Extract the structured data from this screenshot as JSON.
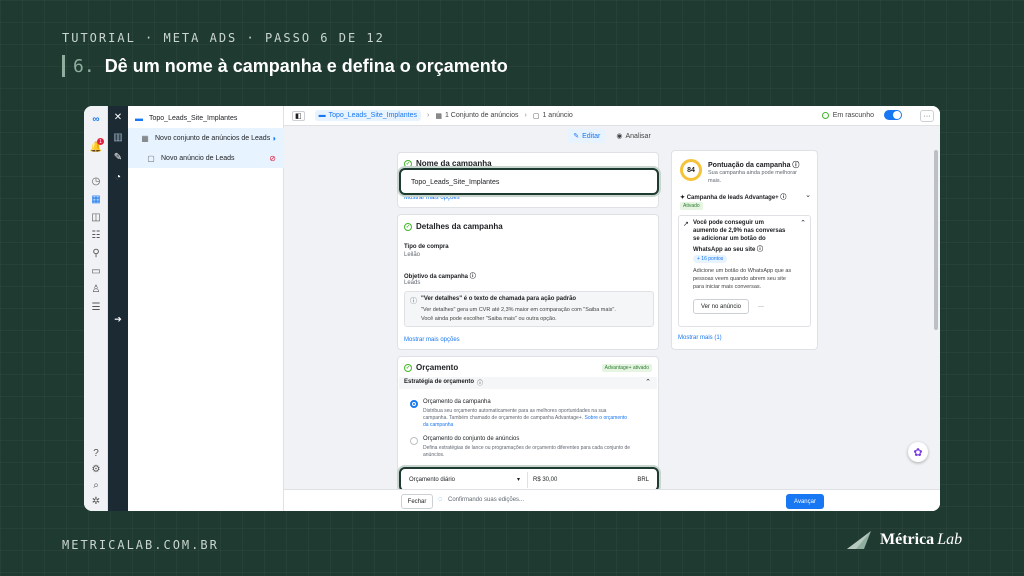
{
  "slide": {
    "kicker": "TUTORIAL · META ADS · PASSO 6 DE 12",
    "step_number": "6.",
    "step_title": "Dê um nome à campanha e defina o orçamento",
    "footer_url": "METRICALAB.COM.BR",
    "brand_name": "Métrica",
    "brand_suffix": "Lab"
  },
  "colors": {
    "background": "#1f3a31",
    "accent": "#1877f2",
    "highlight_border": "#1f3a31"
  },
  "rail": {
    "icons": [
      "meta-logo-icon",
      "notifications-icon",
      "dashboard-icon",
      "campaigns-icon",
      "audiences-icon",
      "tools-icon",
      "billing-icon",
      "people-icon",
      "menu-icon",
      "help-icon",
      "settings-icon",
      "search-icon",
      "bug-icon"
    ],
    "notification_count": "1"
  },
  "tree": {
    "items": [
      {
        "label": "Topo_Leads_Site_Implantes"
      },
      {
        "label": "Novo conjunto de anúncios de Leads"
      },
      {
        "label": "Novo anúncio de Leads"
      }
    ]
  },
  "topbar": {
    "crumb_campaign": "Topo_Leads_Site_Implantes",
    "crumb_adset": "1 Conjunto de anúncios",
    "crumb_ad": "1 anúncio",
    "status": "Em rascunho",
    "more": "···"
  },
  "modes": {
    "edit": "Editar",
    "review": "Analisar"
  },
  "name_card": {
    "title": "Nome da campanha",
    "value": "Topo_Leads_Site_Implantes",
    "more_options": "Mostrar mais opções"
  },
  "details_card": {
    "title": "Detalhes da campanha",
    "buy_type_label": "Tipo de compra",
    "buy_type_value": "Leilão",
    "objective_label": "Objetivo da campanha",
    "objective_value": "Leads",
    "info_title": "\"Ver detalhes\" é o texto de chamada para ação padrão",
    "info_body_1": "\"Ver detalhes\" gera um CVR até 2,3% maior em comparação com \"Saiba mais\".",
    "info_body_2": "Você ainda pode escolher \"Saiba mais\" ou outra opção.",
    "more_options": "Mostrar mais opções"
  },
  "budget_card": {
    "title": "Orçamento",
    "advantage_tag": "Advantage+ ativado",
    "strategy_label": "Estratégia de orçamento",
    "option1_title": "Orçamento da campanha",
    "option1_desc_1": "Distribua seu orçamento automaticamente para as melhores oportunidades na sua",
    "option1_desc_2": "campanha. Também chamado de orçamento de campanha Advantage+.",
    "option1_link": "Sobre o orçamento",
    "option1_link_2": "da campanha",
    "option2_title": "Orçamento do conjunto de anúncios",
    "option2_desc_1": "Defina estratégias de lance ou programações de orçamento diferentes para cada conjunto de",
    "option2_desc_2": "anúncios.",
    "budget_type": "Orçamento diário",
    "budget_amount": "R$ 30,00",
    "currency": "BRL"
  },
  "score_panel": {
    "score": "84",
    "title": "Pontuação da campanha",
    "subtitle_1": "Sua campanha ainda pode melhorar",
    "subtitle_2": "mais.",
    "advantage_label": "Campanha de leads Advantage+",
    "advantage_status": "Ativado",
    "tip_title_1": "Você pode conseguir um",
    "tip_title_2": "aumento de 2,9% nas conversas",
    "tip_title_3": "se adicionar um botão do",
    "tip_title_4": "WhatsApp ao seu site",
    "points": "+ 16 pontos",
    "tip_body_1": "Adicione um botão do WhatsApp que as",
    "tip_body_2": "pessoas veem quando abrem seu site",
    "tip_body_3": "para iniciar mais conversas.",
    "view_button": "Ver no anúncio",
    "dots": "···",
    "show_more": "Mostrar mais (1)"
  },
  "bottom": {
    "close": "Fechar",
    "saving": "Confirmando suas edições...",
    "next": "Avançar"
  }
}
